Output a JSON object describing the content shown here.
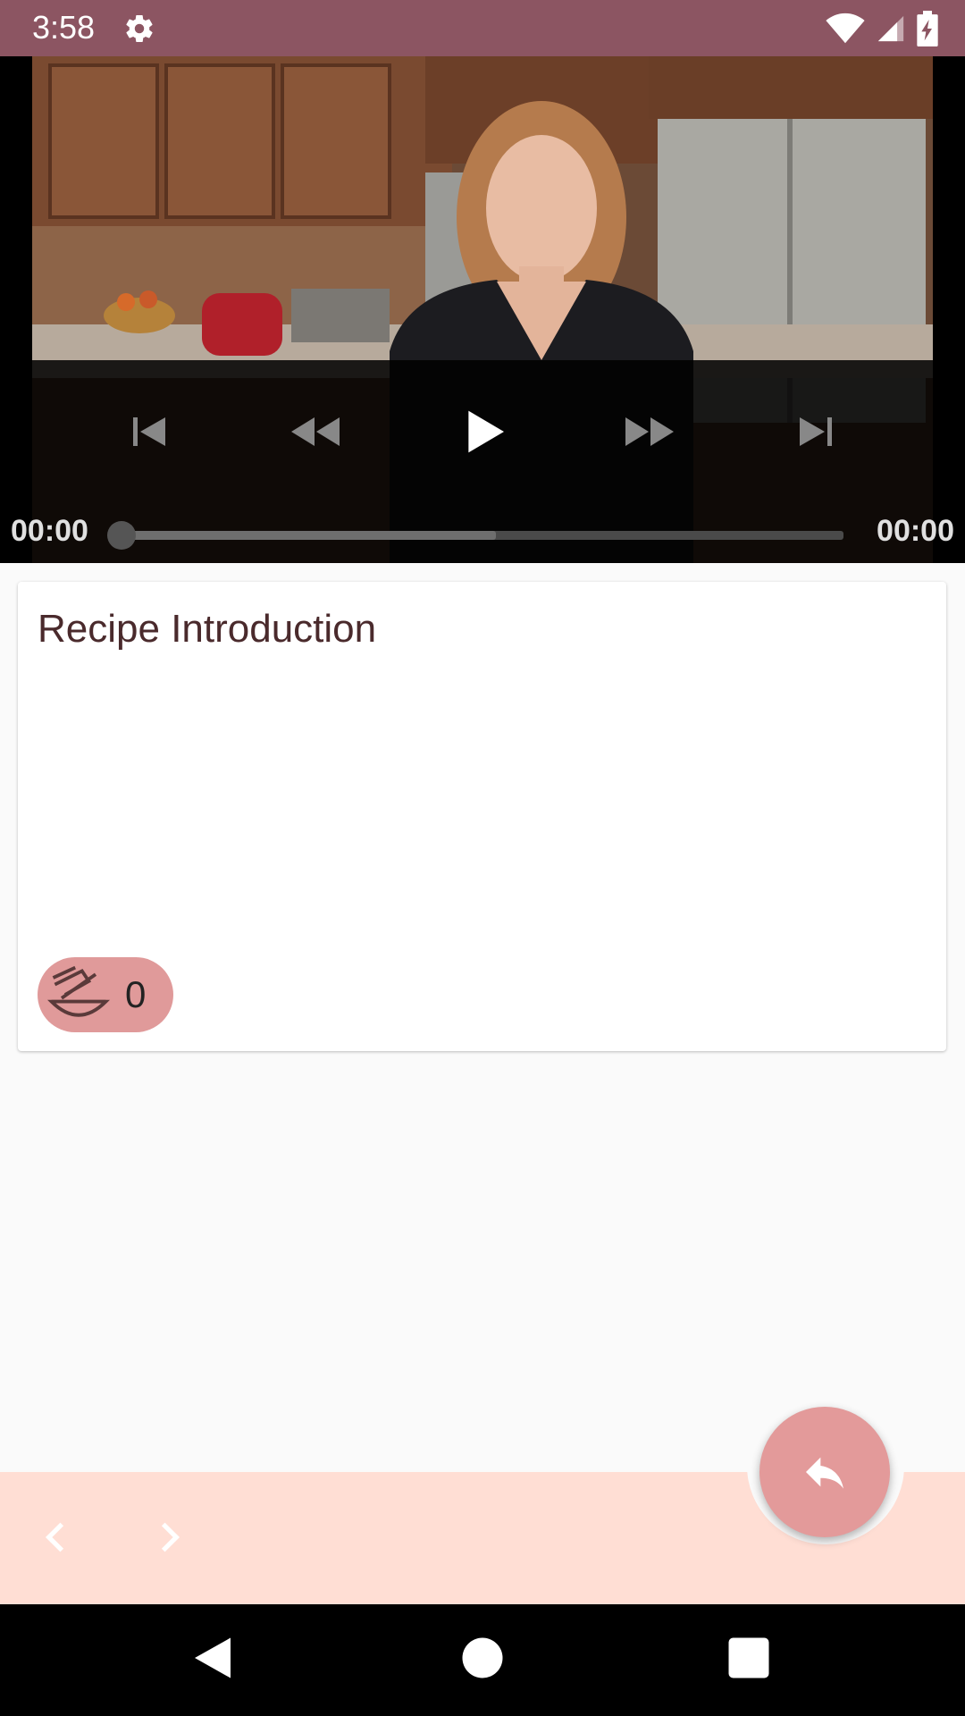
{
  "status_bar": {
    "time": "3:58",
    "icons": [
      "settings-gear-icon",
      "wifi-icon",
      "cell-signal-icon",
      "battery-charging-icon"
    ],
    "color": "#8c5562"
  },
  "video": {
    "time_current": "00:00",
    "time_total": "00:00",
    "progress": 0.0,
    "buffered": 0.52,
    "controls": [
      "skip-previous-icon",
      "rewind-icon",
      "play-icon",
      "fast-forward-icon",
      "skip-next-icon"
    ]
  },
  "card": {
    "title": "Recipe Introduction",
    "chip": {
      "icon": "mixing-bowl-whisk-icon",
      "count": "0"
    }
  },
  "bottom_bar": {
    "background": "#ffded4",
    "prev_icon": "chevron-left-icon",
    "next_icon": "chevron-right-icon",
    "fab_icon": "reply-icon",
    "fab_color": "#e39a9a"
  },
  "system_nav": {
    "icons": [
      "back-triangle-icon",
      "home-circle-icon",
      "recents-square-icon"
    ]
  }
}
